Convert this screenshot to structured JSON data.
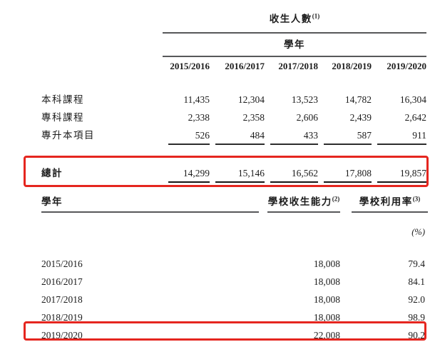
{
  "page": {
    "text_color": "#1c1c1c",
    "highlight_color": "#e5261f",
    "background_color": "#ffffff"
  },
  "enrollment_table": {
    "title": "收生人數",
    "title_sup": "(1)",
    "subtitle": "學年",
    "year_headers": [
      "2015/2016",
      "2016/2017",
      "2017/2018",
      "2018/2019",
      "2019/2020"
    ],
    "rows": [
      {
        "label": "本科課程",
        "values": [
          "11,435",
          "12,304",
          "13,523",
          "14,782",
          "16,304"
        ]
      },
      {
        "label": "專科課程",
        "values": [
          "2,338",
          "2,358",
          "2,606",
          "2,439",
          "2,642"
        ]
      },
      {
        "label": "專升本項目",
        "values": [
          "526",
          "484",
          "433",
          "587",
          "911"
        ]
      }
    ],
    "total": {
      "label": "總計",
      "values": [
        "14,299",
        "15,146",
        "16,562",
        "17,808",
        "19,857"
      ]
    }
  },
  "capacity_table": {
    "col_year": "學年",
    "col_capacity": "學校收生能力",
    "col_capacity_sup": "(2)",
    "col_utilization": "學校利用率",
    "col_utilization_sup": "(3)",
    "unit_label": "(%)",
    "rows": [
      {
        "year": "2015/2016",
        "capacity": "18,008",
        "utilization": "79.4"
      },
      {
        "year": "2016/2017",
        "capacity": "18,008",
        "utilization": "84.1"
      },
      {
        "year": "2017/2018",
        "capacity": "18,008",
        "utilization": "92.0"
      },
      {
        "year": "2018/2019",
        "capacity": "18,008",
        "utilization": "98.9"
      },
      {
        "year": "2019/2020",
        "capacity": "22,008",
        "utilization": "90.2"
      }
    ]
  }
}
